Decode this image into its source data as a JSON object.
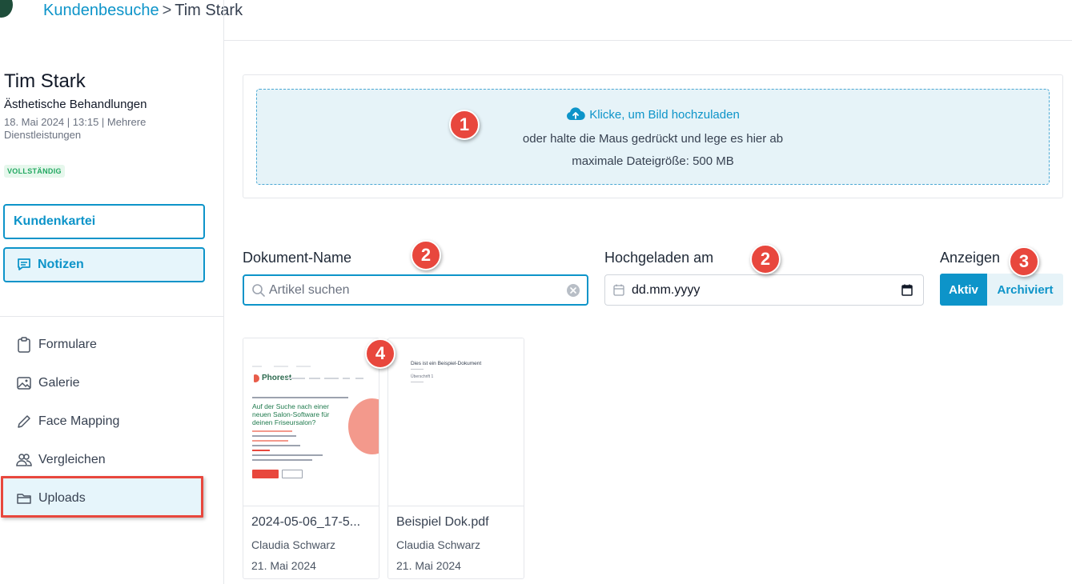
{
  "breadcrumb": {
    "parent": "Kundenbesuche",
    "separator": ">",
    "current": "Tim Stark"
  },
  "client": {
    "name": "Tim Stark",
    "service": "Ästhetische Behandlungen",
    "meta": "18. Mai 2024 | 13:15 | Mehrere Dienstleistungen",
    "status": "VOLLSTÄNDIG"
  },
  "sidebar": {
    "buttons": {
      "kundenkartei": "Kundenkartei",
      "notizen": "Notizen"
    },
    "nav": [
      {
        "label": "Formulare",
        "icon": "clipboard-icon"
      },
      {
        "label": "Galerie",
        "icon": "image-icon"
      },
      {
        "label": "Face Mapping",
        "icon": "pencil-icon"
      },
      {
        "label": "Vergleichen",
        "icon": "users-icon"
      },
      {
        "label": "Uploads",
        "icon": "folder-icon",
        "active": true
      }
    ]
  },
  "upload": {
    "link_label": "Klicke, um Bild hochzuladen",
    "hint": "oder halte die Maus gedrückt und lege es hier ab",
    "max_size": "maximale Dateigröße: 500 MB"
  },
  "filters": {
    "name_label": "Dokument-Name",
    "search_placeholder": "Artikel suchen",
    "date_label": "Hochgeladen am",
    "date_placeholder": "dd.mm.yyyy",
    "show_label": "Anzeigen",
    "toggle_active": "Aktiv",
    "toggle_archived": "Archiviert"
  },
  "documents": [
    {
      "title": "2024-05-06_17-5...",
      "author": "Claudia Schwarz",
      "date": "21. Mai 2024",
      "thumb": {
        "logo": "Phorest",
        "headline": "Auf der Suche nach einer neuen Salon-Software für deinen Friseursalon?"
      }
    },
    {
      "title": "Beispiel Dok.pdf",
      "author": "Claudia Schwarz",
      "date": "21. Mai 2024",
      "thumb": {
        "heading": "Dies ist ein Beispiel-Dokument",
        "subheading": "Überschrift 1"
      }
    }
  ],
  "callouts": [
    "1",
    "2",
    "2",
    "3",
    "4"
  ],
  "colors": {
    "accent": "#0d94c9",
    "highlight": "#e8473d",
    "success": "#22a861",
    "brand_dark": "#1e4d3a"
  }
}
